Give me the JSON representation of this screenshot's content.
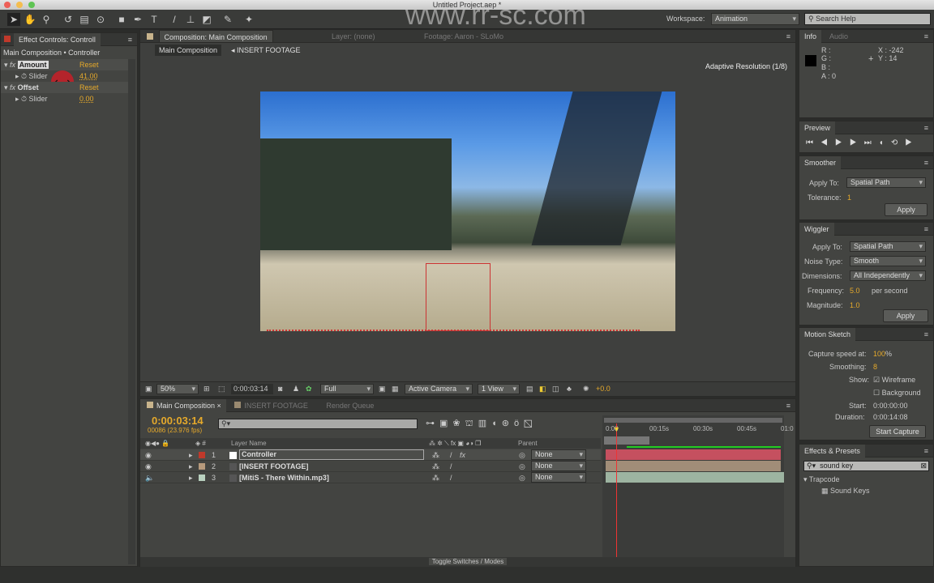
{
  "window": {
    "title": "Untitled Project.aep *"
  },
  "watermark": "www.rr-sc.com",
  "toolbar": {
    "workspace_label": "Workspace:",
    "workspace_value": "Animation",
    "search_placeholder": "Search Help"
  },
  "effect_controls": {
    "tab": "Effect Controls: Controll",
    "breadcrumb": "Main Composition • Controller",
    "effects": [
      {
        "name": "Amount",
        "reset": "Reset",
        "param": "Slider",
        "value": "41.00"
      },
      {
        "name": "Offset",
        "reset": "Reset",
        "param": "Slider",
        "value": "0.00"
      }
    ]
  },
  "composition": {
    "tab": "Composition: Main Composition",
    "layer_tab": "Layer: (none)",
    "footage_tab": "Footage: Aaron - SLoMo",
    "crumb1": "Main Composition",
    "crumb2": "INSERT FOOTAGE",
    "adaptive": "Adaptive Resolution (1/8)",
    "zoom": "50%",
    "time": "0:00:03:14",
    "resolution": "Full",
    "camera": "Active Camera",
    "views": "1 View",
    "exposure": "+0.0"
  },
  "timeline": {
    "tabs": [
      "Main Composition",
      "INSERT FOOTAGE",
      "Render Queue"
    ],
    "timecode": "0:00:03:14",
    "frames": "00086 (23.976 fps)",
    "col_layer": "Layer Name",
    "col_parent": "Parent",
    "ruler": [
      "0:00",
      "00:15s",
      "00:30s",
      "00:45s",
      "01:0"
    ],
    "layers": [
      {
        "num": "1",
        "name": "Controller",
        "parent": "None",
        "color": "#c0392b"
      },
      {
        "num": "2",
        "name": "[INSERT FOOTAGE]",
        "parent": "None",
        "color": "#b79a7c"
      },
      {
        "num": "3",
        "name": "[MitiS - There Within.mp3]",
        "parent": "None",
        "color": "#b9d1bf"
      }
    ],
    "toggle": "Toggle Switches / Modes"
  },
  "info": {
    "tab": "Info",
    "tab2": "Audio",
    "r": "R :",
    "g": "G :",
    "b": "B :",
    "a": "A : 0",
    "x": "X : -242",
    "y": "Y : 14"
  },
  "preview": {
    "tab": "Preview"
  },
  "smoother": {
    "tab": "Smoother",
    "apply_to_label": "Apply To:",
    "apply_to": "Spatial Path",
    "tolerance_label": "Tolerance:",
    "tolerance": "1",
    "apply": "Apply"
  },
  "wiggler": {
    "tab": "Wiggler",
    "apply_to_label": "Apply To:",
    "apply_to": "Spatial Path",
    "noise_label": "Noise Type:",
    "noise": "Smooth",
    "dim_label": "Dimensions:",
    "dim": "All Independently",
    "freq_label": "Frequency:",
    "freq": "5.0",
    "freq_unit": "per second",
    "mag_label": "Magnitude:",
    "mag": "1.0",
    "apply": "Apply"
  },
  "motion_sketch": {
    "tab": "Motion Sketch",
    "speed_label": "Capture speed at:",
    "speed": "100",
    "pct": "%",
    "smooth_label": "Smoothing:",
    "smooth": "8",
    "show_label": "Show:",
    "wireframe": "Wireframe",
    "background": "Background",
    "start_label": "Start:",
    "start": "0:00:00:00",
    "dur_label": "Duration:",
    "dur": "0:00:14:08",
    "capture": "Start Capture"
  },
  "effects_presets": {
    "tab": "Effects & Presets",
    "search": "sound key",
    "group": "Trapcode",
    "item": "Sound Keys"
  }
}
